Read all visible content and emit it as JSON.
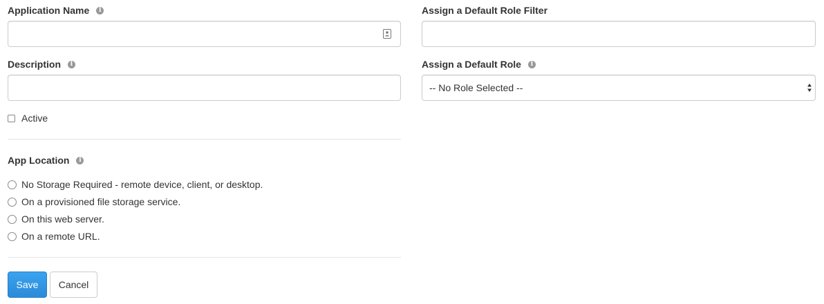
{
  "form": {
    "application_name": {
      "label": "Application Name",
      "value": "",
      "info_icon": "info-icon",
      "field_icon": "contact-card-icon"
    },
    "description": {
      "label": "Description",
      "value": "",
      "info_icon": "info-icon"
    },
    "active": {
      "label": "Active",
      "checked": false
    },
    "app_location": {
      "label": "App Location",
      "info_icon": "info-icon",
      "options": [
        {
          "label": "No Storage Required - remote device, client, or desktop.",
          "selected": false
        },
        {
          "label": "On a provisioned file storage service.",
          "selected": false
        },
        {
          "label": "On this web server.",
          "selected": false
        },
        {
          "label": "On a remote URL.",
          "selected": false
        }
      ]
    },
    "default_role_filter": {
      "label": "Assign a Default Role Filter",
      "value": ""
    },
    "default_role": {
      "label": "Assign a Default Role",
      "info_icon": "info-icon",
      "selected": "-- No Role Selected --"
    }
  },
  "buttons": {
    "save_label": "Save",
    "cancel_label": "Cancel"
  },
  "colors": {
    "primary": "#2f95e4",
    "border": "#cccccc",
    "label": "#333333",
    "info_icon": "#999999"
  }
}
